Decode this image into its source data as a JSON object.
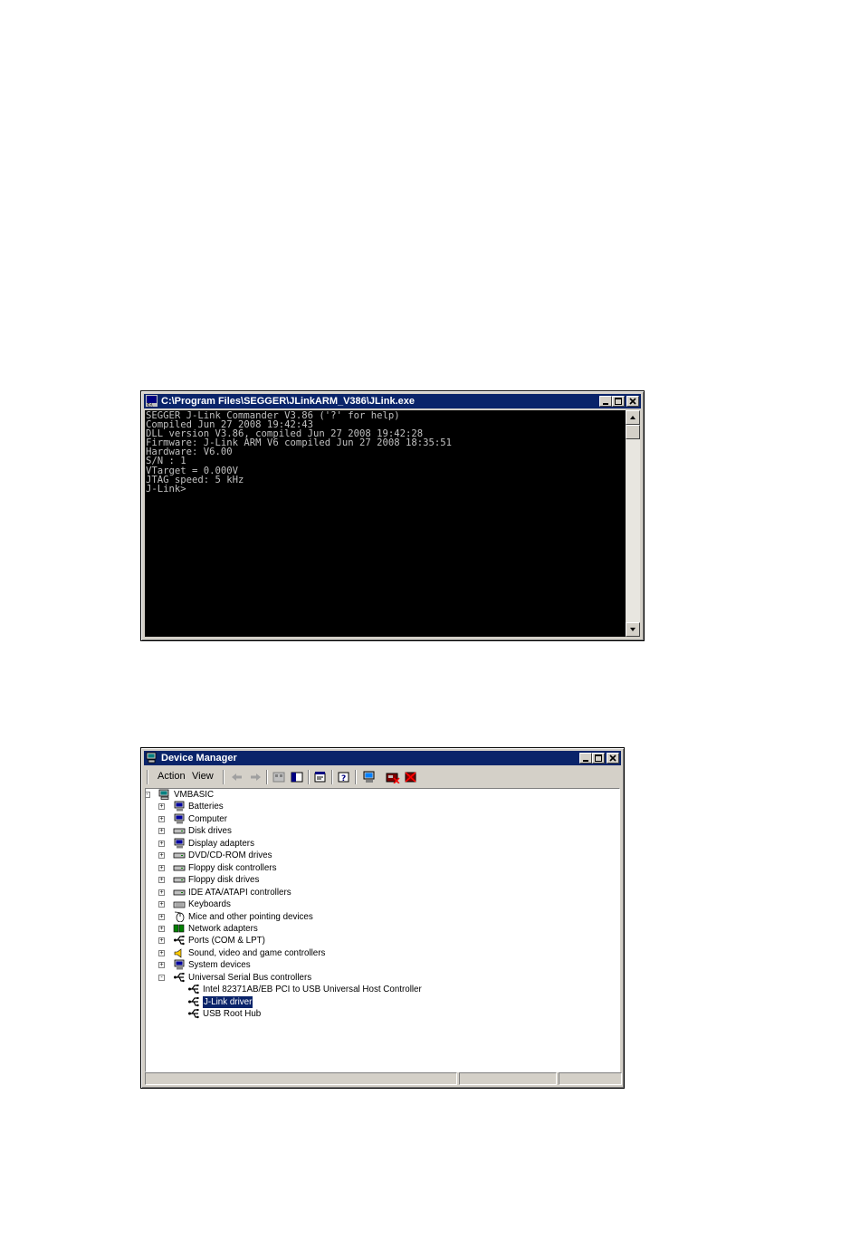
{
  "console": {
    "title": "C:\\Program Files\\SEGGER\\JLinkARM_V386\\JLink.exe",
    "lines": [
      "SEGGER J-Link Commander V3.86 ('?' for help)",
      "Compiled Jun 27 2008 19:42:43",
      "DLL version V3.86, compiled Jun 27 2008 19:42:28",
      "Firmware: J-Link ARM V6 compiled Jun 27 2008 18:35:51",
      "Hardware: V6.00",
      "S/N : 1",
      "VTarget = 0.000V",
      "JTAG speed: 5 kHz",
      "J-Link>"
    ]
  },
  "devmgr": {
    "title": "Device Manager",
    "menu": {
      "action": "Action",
      "view": "View"
    },
    "root": "VMBASIC",
    "categories": [
      "Batteries",
      "Computer",
      "Disk drives",
      "Display adapters",
      "DVD/CD-ROM drives",
      "Floppy disk controllers",
      "Floppy disk drives",
      "IDE ATA/ATAPI controllers",
      "Keyboards",
      "Mice and other pointing devices",
      "Network adapters",
      "Ports (COM & LPT)",
      "Sound, video and game controllers",
      "System devices",
      "Universal Serial Bus controllers"
    ],
    "usb_children": [
      "Intel 82371AB/EB PCI to USB Universal Host Controller",
      "J-Link driver",
      "USB Root Hub"
    ],
    "selected": "J-Link driver"
  }
}
